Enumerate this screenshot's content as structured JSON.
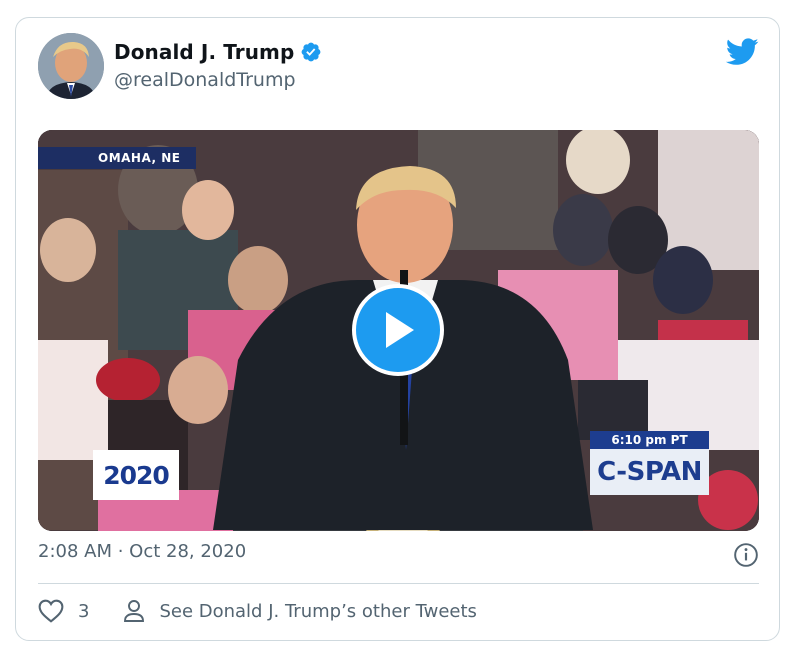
{
  "tweet": {
    "display_name": "Donald J. Trump",
    "handle": "@realDonaldTrump",
    "timestamp": "2:08 AM · Oct 28, 2020",
    "like_count": "3",
    "other_tweets_label": "See Donald J. Trump’s other Tweets"
  },
  "media": {
    "location_label": "OMAHA, NE",
    "time_label": "6:10 pm PT",
    "network_label": "C-SPAN",
    "event_logo": "2020"
  },
  "icons": {
    "brand": "twitter-bird-icon",
    "verified": "verified-badge-icon",
    "play": "play-icon",
    "info": "info-icon",
    "like": "heart-icon",
    "profile": "person-icon"
  },
  "colors": {
    "accent": "#1d9bf0",
    "text_primary": "#0f1419",
    "text_secondary": "#536471",
    "border": "#cfd9de"
  }
}
